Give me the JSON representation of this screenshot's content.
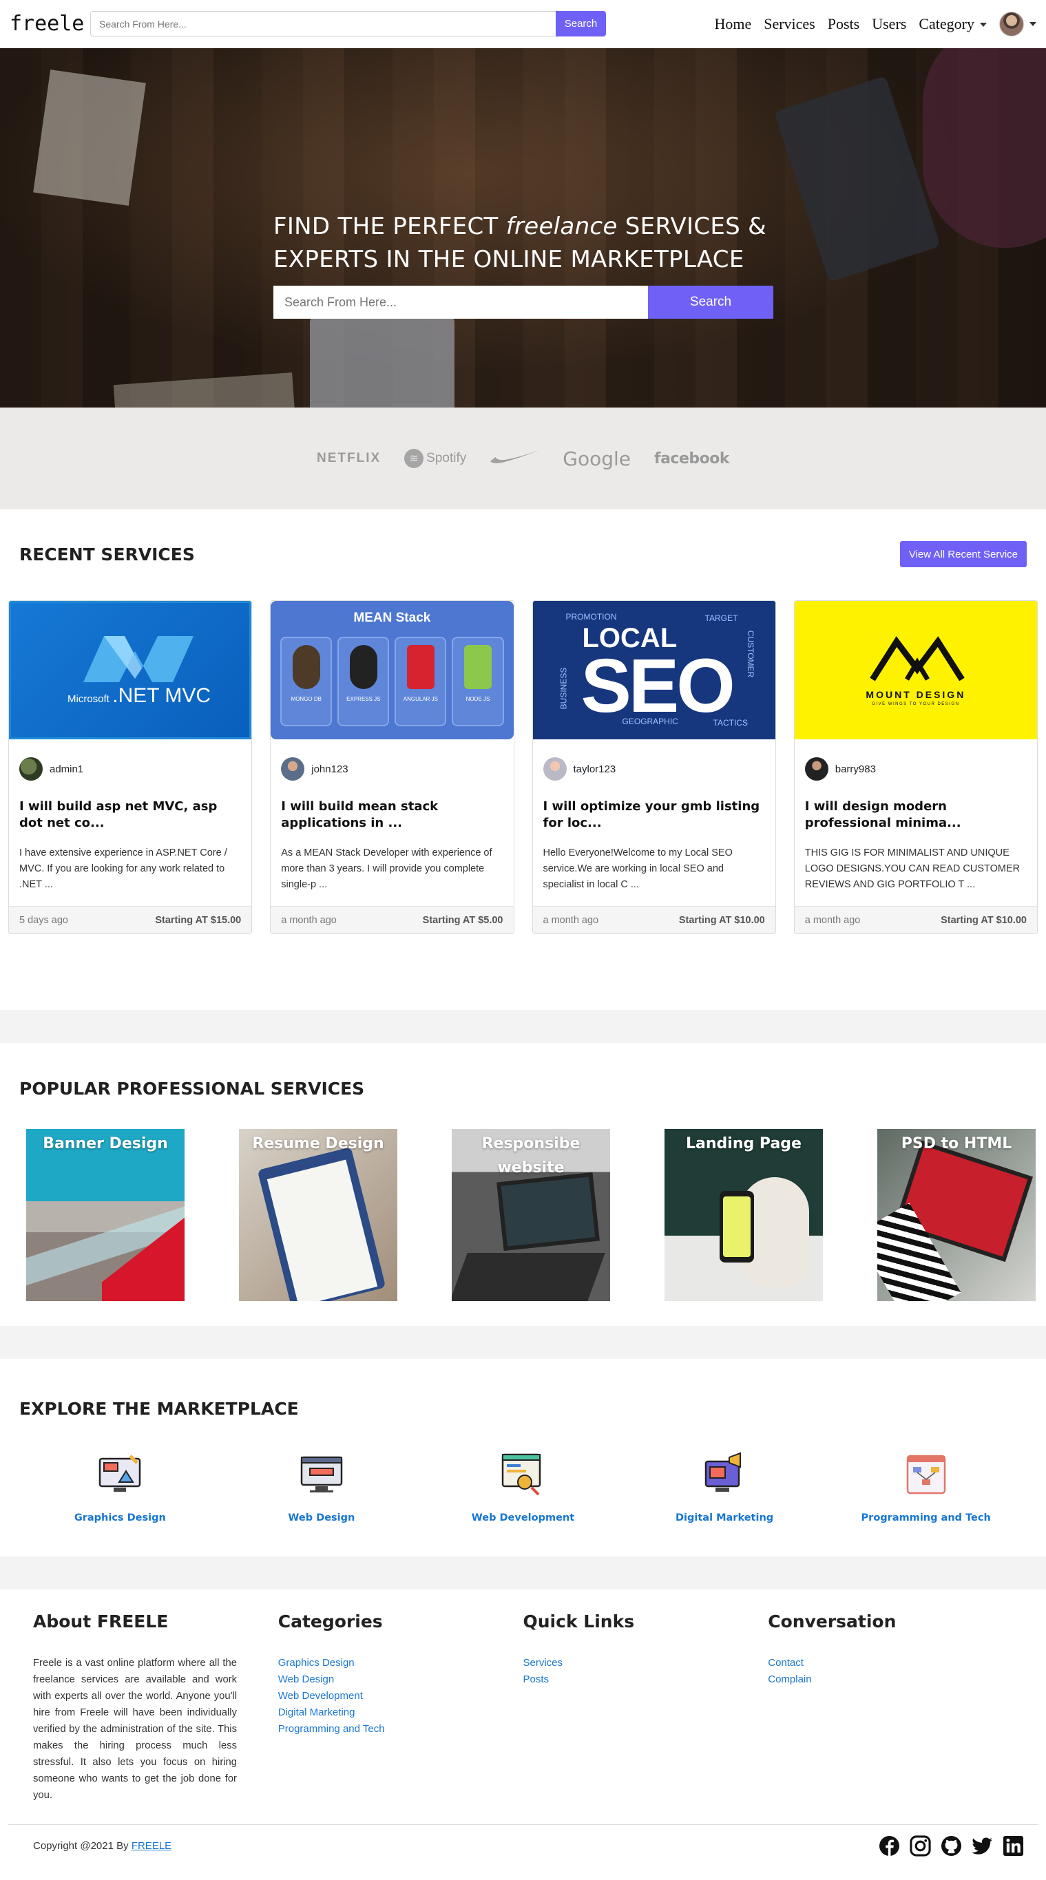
{
  "navbar": {
    "brand": "freele",
    "search_placeholder": "Search From Here...",
    "search_button": "Search",
    "links": [
      "Home",
      "Services",
      "Posts",
      "Users",
      "Category"
    ]
  },
  "hero": {
    "title_part1": "FIND THE PERFECT ",
    "title_em": "freelance",
    "title_part2": " SERVICES & EXPERTS IN THE ONLINE MARKETPLACE",
    "search_placeholder": "Search From Here...",
    "search_button": "Search"
  },
  "brands": [
    "NETFLIX",
    "Spotify",
    "NIKE",
    "Google",
    "facebook"
  ],
  "recent": {
    "title": "RECENT SERVICES",
    "view_all": "View All Recent Service",
    "cards": [
      {
        "image_text_small": "Microsoft",
        "image_text_big": ".NET MVC",
        "author": "admin1",
        "title": "I will build asp net MVC, asp dot net co...",
        "text": "I have extensive experience in  ASP.NET Core / MVC. If you are looking for any work related to .NET ...",
        "time": "5 days ago",
        "price": "Starting AT $15.00"
      },
      {
        "image_title": "MEAN Stack",
        "image_tiles": [
          "MONGO DB",
          "EXPRESS JS",
          "ANGULAR JS",
          "NODE JS"
        ],
        "author": "john123",
        "title": "I will build mean stack applications in ...",
        "text": "As a MEAN Stack Developer with experience of more than 3 years. I will provide you complete single-p ...",
        "time": "a month ago",
        "price": "Starting AT $5.00"
      },
      {
        "image_text_local": "LOCAL",
        "image_text_seo": "SEO",
        "image_tags": [
          "PROMOTION",
          "TARGET",
          "BUSINESS",
          "CUSTOMER",
          "GEOGRAPHIC",
          "TACTICS"
        ],
        "author": "taylor123",
        "title": "I will optimize your gmb listing for loc...",
        "text": "Hello Everyone!Welcome to my Local SEO service.We are working in local SEO and specialist in local C ...",
        "time": "a month ago",
        "price": "Starting AT $10.00"
      },
      {
        "image_name": "MOUNT DESIGN",
        "image_tagline": "GIVE WINGS TO YOUR DESIGN",
        "author": "barry983",
        "title": "I will design modern professional minima...",
        "text": "THIS GIG IS FOR MINIMALIST AND UNIQUE LOGO DESIGNS.YOU CAN READ CUSTOMER REVIEWS AND GIG PORTFOLIO T ...",
        "time": "a month ago",
        "price": "Starting AT $10.00"
      }
    ]
  },
  "popular": {
    "title": "POPULAR PROFESSIONAL SERVICES",
    "tiles": [
      "Banner Design",
      "Resume Design",
      "Responsibe website",
      "Landing Page",
      "PSD to HTML"
    ]
  },
  "explore": {
    "title": "EXPLORE THE MARKETPLACE",
    "items": [
      {
        "label": "Graphics Design",
        "icon": "graphics-design-icon"
      },
      {
        "label": "Web Design",
        "icon": "web-design-icon"
      },
      {
        "label": "Web Development",
        "icon": "web-development-icon"
      },
      {
        "label": "Digital Marketing",
        "icon": "digital-marketing-icon"
      },
      {
        "label": "Programming and Tech",
        "icon": "programming-tech-icon"
      }
    ]
  },
  "footer": {
    "about_title": "About FREELE",
    "about_text": "Freele is a vast online platform where all the freelance services are available and work with experts all over the world. Anyone you'll hire from Freele will have been individually verified by the administration of the site. This makes the hiring process much less stressful. It also lets you focus on hiring someone who wants to get the job done for you.",
    "categories_title": "Categories",
    "categories": [
      "Graphics Design",
      "Web Design",
      "Web Development",
      "Digital Marketing",
      "Programming and Tech"
    ],
    "quick_title": "Quick Links",
    "quick_links": [
      "Services",
      "Posts"
    ],
    "conversation_title": "Conversation",
    "conversation_links": [
      "Contact",
      "Complain"
    ],
    "copyright_prefix": "Copyright @2021 By ",
    "copyright_link": "FREELE",
    "socials": [
      "facebook-icon",
      "instagram-icon",
      "github-icon",
      "twitter-icon",
      "linkedin-icon"
    ]
  },
  "colors": {
    "accent": "#6f61f6",
    "link": "#1976d2",
    "brands_band": "#eceae8"
  }
}
